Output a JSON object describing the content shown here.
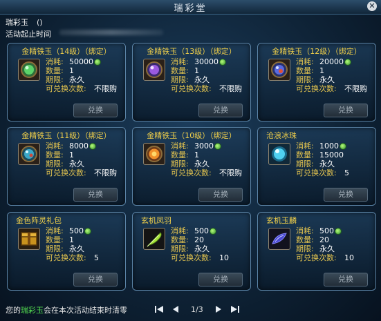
{
  "window": {
    "title": "瑞彩堂"
  },
  "header": {
    "currency_name": "瑞彩玉",
    "currency_count": "()",
    "period_label": "活动起止时间"
  },
  "labels": {
    "cost": "消耗:",
    "qty": "数量:",
    "term": "期限:",
    "times": "可兑换次数:"
  },
  "items": [
    {
      "name": "金精铁玉（14级）（绑定）",
      "cost": "50000",
      "qty": "1",
      "term": "永久",
      "times": "不限购",
      "button": "兑换",
      "icon": "purple-gem-icon",
      "color": "#3fae3f"
    },
    {
      "name": "金精铁玉（13级）（绑定）",
      "cost": "30000",
      "qty": "1",
      "term": "永久",
      "times": "不限购",
      "button": "兑换",
      "icon": "purple-gem-icon",
      "color": "#8a3fd0"
    },
    {
      "name": "金精铁玉（12级）（绑定）",
      "cost": "20000",
      "qty": "1",
      "term": "永久",
      "times": "不限购",
      "button": "兑换",
      "icon": "blue-gem-icon",
      "color": "#4a5fd0"
    },
    {
      "name": "金精铁玉（11级）（绑定）",
      "cost": "8000",
      "qty": "1",
      "term": "永久",
      "times": "不限购",
      "button": "兑换",
      "icon": "teal-gem-icon",
      "color": "#2f8fa8"
    },
    {
      "name": "金精铁玉（10级）（绑定）",
      "cost": "3000",
      "qty": "1",
      "term": "永久",
      "times": "不限购",
      "button": "兑换",
      "icon": "orange-gem-icon",
      "color": "#e0801e"
    },
    {
      "name": "沧浪冰珠",
      "cost": "1000",
      "qty": "15000",
      "term": "永久",
      "times": "5",
      "button": "兑换",
      "icon": "ice-orb-icon",
      "color": "#4fc8e8"
    },
    {
      "name": "金色阵灵礼包",
      "cost": "500",
      "qty": "1",
      "term": "永久",
      "times": "5",
      "button": "兑换",
      "icon": "gift-chest-icon",
      "color": "#d9a21e"
    },
    {
      "name": "玄机凤羽",
      "cost": "500",
      "qty": "20",
      "term": "永久",
      "times": "10",
      "button": "兑换",
      "icon": "feather-icon",
      "color": "#9fdc3a"
    },
    {
      "name": "玄机玉麟",
      "cost": "500",
      "qty": "20",
      "term": "永久",
      "times": "10",
      "button": "兑换",
      "icon": "scale-icon",
      "color": "#5a5ad8"
    }
  ],
  "footer": {
    "note_prefix": "您的",
    "note_highlight": "瑞彩玉",
    "note_suffix": "会在本次活动结束时清零",
    "page_indicator": "1/3"
  }
}
